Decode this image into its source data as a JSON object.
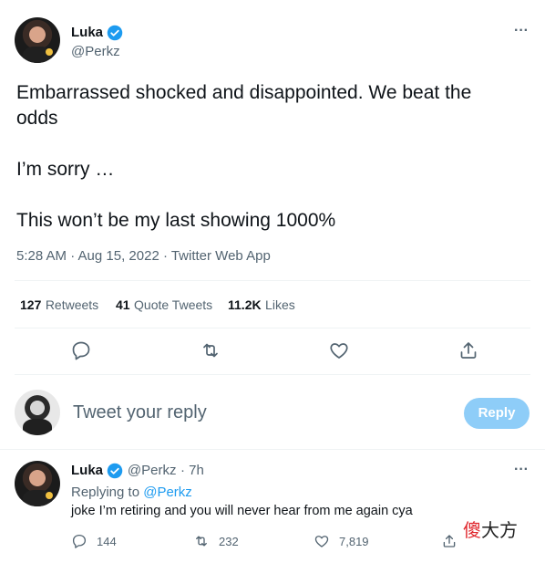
{
  "tweet": {
    "author_name": "Luka",
    "author_handle": "@Perkz",
    "text_line1": "Embarrassed shocked and disappointed. We beat the",
    "text_line2": "odds",
    "text_line3": "I’m sorry …",
    "text_line4": "This won’t be my last showing 1000%",
    "timestamp": "5:28 AM · Aug 15, 2022 · Twitter Web App",
    "stats": {
      "retweets_count": "127",
      "retweets_label": "Retweets",
      "quote_count": "41",
      "quote_label": "Quote Tweets",
      "likes_count": "11.2K",
      "likes_label": "Likes"
    },
    "more_label": "···"
  },
  "reply_box": {
    "placeholder": "Tweet your reply",
    "button_label": "Reply"
  },
  "reply_tweet": {
    "author_name": "Luka",
    "author_handle": "@Perkz",
    "time": "· 7h",
    "replying_prefix": "Replying to",
    "replying_to": "@Perkz",
    "text": "joke I’m retiring and you will never hear from me again cya",
    "reply_count": "144",
    "retweet_count": "232",
    "like_count": "7,819",
    "more_label": "···"
  },
  "watermark": {
    "red_part": "傻",
    "rest": "大方"
  },
  "colors": {
    "accent": "#1d9bf0",
    "reply_button_disabled": "#8ecdf8",
    "secondary_text": "#536471"
  }
}
